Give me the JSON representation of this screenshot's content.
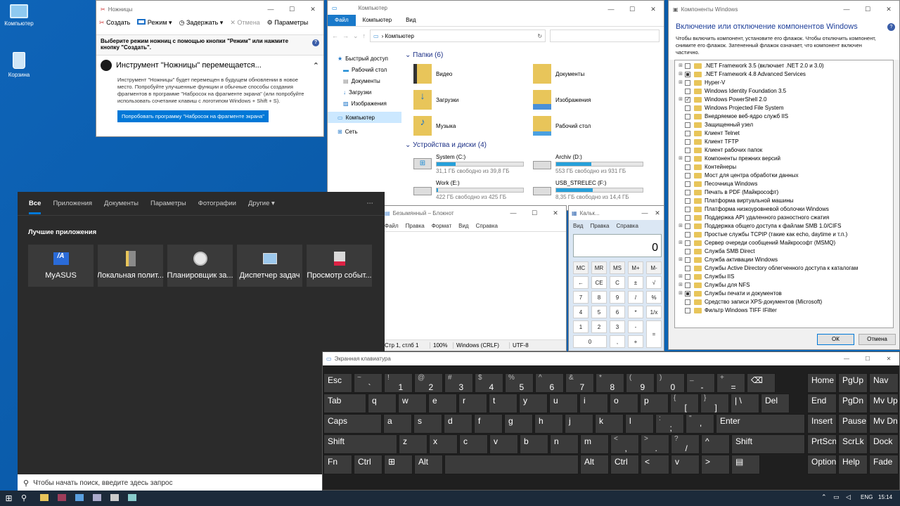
{
  "desktop": {
    "icons": [
      {
        "label": "Компьютер",
        "icon": "computer-icon"
      },
      {
        "label": "Корзина",
        "icon": "recycle-bin-icon"
      }
    ]
  },
  "snipping": {
    "title": "Ножницы",
    "toolbar": [
      "Создать",
      "Режим",
      "Задержать",
      "Отмена",
      "Параметры"
    ],
    "info": "Выберите режим ножниц с помощью кнопки \"Режим\" или нажмите кнопку \"Создать\".",
    "banner_title": "Инструмент \"Ножницы\" перемещается...",
    "banner_text": "Инструмент \"Ножницы\" будет перемещен в будущем обновлении в новое место. Попробуйте улучшенные функции и обычные способы создания фрагментов в программе \"Набросок на фрагменте экрана\" (или попробуйте использовать сочетание клавиш с логотипом Windows + Shift + S).",
    "button": "Попробовать программу \"Набросок на фрагменте экрана\""
  },
  "explorer": {
    "title": "Компьютер",
    "tabs": [
      "Файл",
      "Компьютер",
      "Вид"
    ],
    "address": "Компьютер",
    "nav": [
      "Быстрый доступ",
      "Рабочий стол",
      "Документы",
      "Загрузки",
      "Изображения",
      "Компьютер",
      "Сеть"
    ],
    "folders_header": "Папки (6)",
    "folders": [
      "Видео",
      "Документы",
      "Загрузки",
      "Изображения",
      "Музыка",
      "Рабочий стол"
    ],
    "drives_header": "Устройства и диски (4)",
    "drives": [
      {
        "name": "System (C:)",
        "free": "31,1 ГБ свободно из 39,8 ГБ",
        "used": 0.22
      },
      {
        "name": "Archiv (D:)",
        "free": "553 ГБ свободно из 931 ГБ",
        "used": 0.41
      },
      {
        "name": "Work (E:)",
        "free": "422 ГБ свободно из 425 ГБ",
        "used": 0.01
      },
      {
        "name": "USB_STRELEC (F:)",
        "free": "8,35 ГБ свободно из 14,4 ГБ",
        "used": 0.42
      }
    ]
  },
  "features": {
    "title": "Компоненты Windows",
    "heading": "Включение или отключение компонентов Windows",
    "desc": "Чтобы включить компонент, установите его флажок. Чтобы отключить компонент, снимите его флажок. Затененный флажок означает, что компонент включен частично.",
    "items": [
      {
        "label": ".NET Framework 3.5 (включает .NET 2.0 и 3.0)",
        "state": "off",
        "expand": true
      },
      {
        "label": ".NET Framework 4.8 Advanced Services",
        "state": "part",
        "expand": true
      },
      {
        "label": "Hyper-V",
        "state": "off",
        "expand": true
      },
      {
        "label": "Windows Identity Foundation 3.5",
        "state": "off",
        "expand": false
      },
      {
        "label": "Windows PowerShell 2.0",
        "state": "on",
        "expand": true
      },
      {
        "label": "Windows Projected File System",
        "state": "off",
        "expand": false
      },
      {
        "label": "Внедряемое веб-ядро служб IIS",
        "state": "off",
        "expand": false
      },
      {
        "label": "Защищенный узел",
        "state": "off",
        "expand": false
      },
      {
        "label": "Клиент Telnet",
        "state": "off",
        "expand": false
      },
      {
        "label": "Клиент TFTP",
        "state": "off",
        "expand": false
      },
      {
        "label": "Клиент рабочих папок",
        "state": "off",
        "expand": false
      },
      {
        "label": "Компоненты прежних версий",
        "state": "off",
        "expand": true
      },
      {
        "label": "Контейнеры",
        "state": "off",
        "expand": false
      },
      {
        "label": "Мост для центра обработки данных",
        "state": "off",
        "expand": false
      },
      {
        "label": "Песочница Windows",
        "state": "off",
        "expand": false
      },
      {
        "label": "Печать в PDF (Майкрософт)",
        "state": "off",
        "expand": false
      },
      {
        "label": "Платформа виртуальной машины",
        "state": "off",
        "expand": false
      },
      {
        "label": "Платформа низкоуровневой оболочки Windows",
        "state": "off",
        "expand": false
      },
      {
        "label": "Поддержка API удаленного разностного сжатия",
        "state": "off",
        "expand": false
      },
      {
        "label": "Поддержка общего доступа к файлам SMB 1.0/CIFS",
        "state": "off",
        "expand": true
      },
      {
        "label": "Простые службы TCPIP (такие как echo, daytime и т.п.)",
        "state": "off",
        "expand": false
      },
      {
        "label": "Сервер очереди сообщений Майкрософт (MSMQ)",
        "state": "off",
        "expand": true
      },
      {
        "label": "Служба SMB Direct",
        "state": "off",
        "expand": false
      },
      {
        "label": "Служба активации Windows",
        "state": "off",
        "expand": true
      },
      {
        "label": "Службы Active Directory облегченного доступа к каталогам",
        "state": "off",
        "expand": false
      },
      {
        "label": "Службы IIS",
        "state": "off",
        "expand": true
      },
      {
        "label": "Службы для NFS",
        "state": "off",
        "expand": true
      },
      {
        "label": "Службы печати и документов",
        "state": "part",
        "expand": true
      },
      {
        "label": "Средство записи XPS-документов (Microsoft)",
        "state": "off",
        "expand": false
      },
      {
        "label": "Фильтр Windows TIFF IFilter",
        "state": "off",
        "expand": false
      }
    ],
    "ok": "ОК",
    "cancel": "Отмена"
  },
  "notepad": {
    "title": "Безымянный – Блокнот",
    "menu": [
      "Файл",
      "Правка",
      "Формат",
      "Вид",
      "Справка"
    ],
    "status": [
      "Стр 1, стлб 1",
      "100%",
      "Windows (CRLF)",
      "UTF-8"
    ]
  },
  "calculator": {
    "title": "Кальк...",
    "menu": [
      "Вид",
      "Правка",
      "Справка"
    ],
    "display": "0",
    "mem": [
      "MC",
      "MR",
      "MS",
      "M+",
      "M-"
    ],
    "rows": [
      [
        "←",
        "CE",
        "C",
        "±",
        "√"
      ],
      [
        "7",
        "8",
        "9",
        "/",
        "%"
      ],
      [
        "4",
        "5",
        "6",
        "*",
        "1/x"
      ],
      [
        "1",
        "2",
        "3",
        "-",
        ""
      ],
      [
        "0",
        "",
        ",",
        "+",
        ""
      ]
    ],
    "equals": "="
  },
  "search": {
    "tabs": [
      "Все",
      "Приложения",
      "Документы",
      "Параметры",
      "Фотографии",
      "Другие"
    ],
    "more": "⋯",
    "section": "Лучшие приложения",
    "apps": [
      {
        "label": "MyASUS",
        "icon": "myasus-icon"
      },
      {
        "label": "Локальная полит...",
        "icon": "local-policy-icon"
      },
      {
        "label": "Планировщик за...",
        "icon": "task-scheduler-icon"
      },
      {
        "label": "Диспетчер задач",
        "icon": "task-manager-icon"
      },
      {
        "label": "Просмотр событ...",
        "icon": "event-viewer-icon"
      }
    ],
    "placeholder": "Чтобы начать поиск, введите здесь запрос"
  },
  "keyboard": {
    "title": "Экранная клавиатура",
    "rows": [
      [
        "Esc",
        "~|`",
        "!|1",
        "@|2",
        "#|3",
        "$|4",
        "%|5",
        "^|6",
        "&|7",
        "*|8",
        "(|9",
        ")|0",
        "_|-",
        "+|=",
        "⌫",
        "Home",
        "PgUp",
        "Nav"
      ],
      [
        "Tab",
        "q",
        "w",
        "e",
        "r",
        "t",
        "y",
        "u",
        "i",
        "o",
        "p",
        "{|[",
        "}|]",
        "||\\",
        "Del",
        "End",
        "PgDn",
        "Mv Up"
      ],
      [
        "Caps",
        "a",
        "s",
        "d",
        "f",
        "g",
        "h",
        "j",
        "k",
        "l",
        ":|;",
        "\"|'",
        "Enter",
        "Insert",
        "Pause",
        "Mv Dn"
      ],
      [
        "Shift",
        "z",
        "x",
        "c",
        "v",
        "b",
        "n",
        "m",
        "<|,",
        ">|.",
        "?|/",
        "^",
        "Shift",
        "PrtScn",
        "ScrLk",
        "Dock"
      ],
      [
        "Fn",
        "Ctrl",
        "⊞",
        "Alt",
        "",
        "Alt",
        "Ctrl",
        "<",
        "v",
        ">",
        "▤",
        "Options",
        "Help",
        "Fade"
      ]
    ]
  },
  "taskbar": {
    "lang": "ENG",
    "time": "15:14"
  },
  "colors": {
    "accent": "#0078d7",
    "desktop": "#0b62b5",
    "dark": "#2b2b2b",
    "keyboard": "#1f1f1f"
  }
}
